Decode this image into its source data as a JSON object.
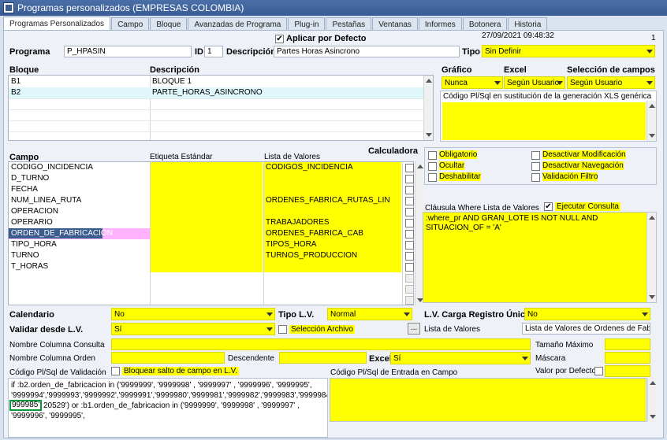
{
  "window": {
    "title": "Programas personalizados (EMPRESAS COLOMBIA)"
  },
  "tabs": [
    "Programas Personalizados",
    "Campo",
    "Bloque",
    "Avanzadas de Programa",
    "Plug-in",
    "Pestañas",
    "Ventanas",
    "Informes",
    "Botonera",
    "Historia"
  ],
  "header": {
    "apply_default_label": "Aplicar por Defecto",
    "datetime": "27/09/2021 09:48:32",
    "page_count": "1",
    "programa_label": "Programa",
    "programa_value": "P_HPASIN",
    "id_label": "ID",
    "id_value": "1",
    "descripcion_label": "Descripción",
    "descripcion_value": "Partes Horas Asincrono",
    "tipo_label": "Tipo",
    "tipo_value": "Sin Definir"
  },
  "blocks": {
    "col_bloque": "Bloque",
    "col_descripcion": "Descripción",
    "rows": [
      {
        "bloque": "B1",
        "descripcion": "BLOQUE 1"
      },
      {
        "bloque": "B2",
        "descripcion": "PARTE_HORAS_ASINCRONO"
      }
    ]
  },
  "report": {
    "grafico_label": "Gráfico",
    "grafico_value": "Nunca",
    "excel_label": "Excel",
    "excel_value": "Según Usuario",
    "seleccion_label": "Selección de campos",
    "seleccion_value": "Según Usuario",
    "codigo_xls_label": "Código Pl/Sql en sustitución de la generación XLS genérica"
  },
  "fields": {
    "col_campo": "Campo",
    "col_etiqueta": "Etiqueta Estándar",
    "col_lista": "Lista de Valores",
    "col_calc": "Calculadora",
    "rows": [
      {
        "campo": "CODIGO_INCIDENCIA",
        "lista": "CODIGOS_INCIDENCIA"
      },
      {
        "campo": "D_TURNO",
        "lista": ""
      },
      {
        "campo": "FECHA",
        "lista": ""
      },
      {
        "campo": "NUM_LINEA_RUTA",
        "lista": "ORDENES_FABRICA_RUTAS_LIN"
      },
      {
        "campo": "OPERACION",
        "lista": ""
      },
      {
        "campo": "OPERARIO",
        "lista": "TRABAJADORES"
      },
      {
        "campo": "ORDEN_DE_FABRICACION",
        "lista": "ORDENES_FABRICA_CAB"
      },
      {
        "campo": "TIPO_HORA",
        "lista": "TIPOS_HORA"
      },
      {
        "campo": "TURNO",
        "lista": "TURNOS_PRODUCCION"
      },
      {
        "campo": "T_HORAS",
        "lista": ""
      }
    ]
  },
  "options": {
    "obligatorio": "Obligatorio",
    "ocultar": "Ocultar",
    "deshabilitar": "Deshabilitar",
    "desactivar_mod": "Desactivar Modificación",
    "desactivar_nav": "Desactivar Navegación",
    "validacion_filtro": "Validación Filtro",
    "clausula_label": "Cláusula Where Lista de Valores",
    "ejecutar_label": "Ejecutar Consulta",
    "clausula_value": ":where_pr AND GRAN_LOTE IS NOT NULL AND SITUACION_OF = 'A'"
  },
  "bottom": {
    "calendario_label": "Calendario",
    "calendario_value": "No",
    "tipo_lv_label": "Tipo L.V.",
    "tipo_lv_value": "Normal",
    "lv_carga_label": "L.V. Carga Registro Único",
    "lv_carga_value": "No",
    "validar_label": "Validar desde L.V.",
    "validar_value": "Sí",
    "seleccion_archivo_label": "Selección Archivo",
    "ellipsis": "...",
    "lista_valores_label": "Lista de Valores",
    "lista_valores_value": "Lista de Valores de Ordenes de Fabrica",
    "nombre_col_consulta_label": "Nombre Columna Consulta",
    "tamano_max_label": "Tamaño Máximo",
    "nombre_col_orden_label": "Nombre Columna Orden",
    "descendente_label": "Descendente",
    "excel_label": "Excel",
    "excel_value": "Sí",
    "mascara_label": "Máscara",
    "codigo_validacion_label": "Código Pl/Sql de Validación",
    "bloquear_label": "Bloquear salto de campo en L.V.",
    "codigo_entrada_label": "Código Pl/Sql de Entrada en Campo",
    "valor_defecto_label": "Valor por Defecto",
    "codigo_lines": [
      "if :b2.orden_de_fabricacion in  ('9999999', '9999998' , '9999997' , '9999996', '9999995',",
      "'9999994','9999993','9999992','9999991','9999980','9999981','9999982','9999983','9999984','9",
      "20529') or :b1.orden_de_fabricacion  in  ('9999999', '9999998' , '9999997' ,",
      "'9999996', '9999995',"
    ],
    "highlight_text": "999985'"
  }
}
